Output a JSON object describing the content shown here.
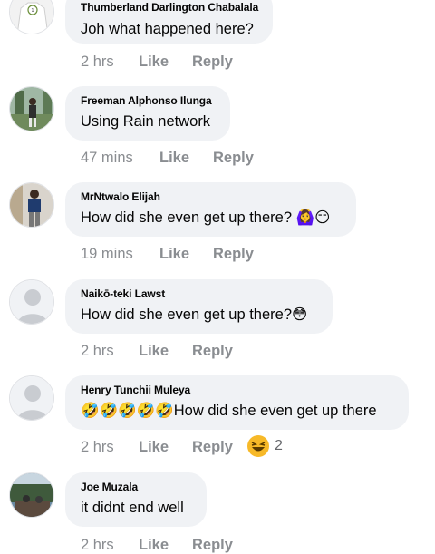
{
  "comments": [
    {
      "name": "Thumberland Darlington Chabalala",
      "text": "Joh what happened here?",
      "time": "2 hrs",
      "like": "Like",
      "reply": "Reply"
    },
    {
      "name": "Freeman Alphonso Ilunga",
      "text": "Using Rain network",
      "time": "47 mins",
      "like": "Like",
      "reply": "Reply"
    },
    {
      "name": "MrNtwalo Elijah",
      "text": "How did she even get up there? 🙆‍♀️😑",
      "time": "19 mins",
      "like": "Like",
      "reply": "Reply"
    },
    {
      "name": "Naikō-teki Lawst",
      "text": "How did she even get up there?😳",
      "time": "2 hrs",
      "like": "Like",
      "reply": "Reply"
    },
    {
      "name": "Henry Tunchii Muleya",
      "text": "🤣🤣🤣🤣🤣How did she even get up there",
      "time": "2 hrs",
      "like": "Like",
      "reply": "Reply",
      "reaction_count": "2"
    },
    {
      "name": "Joe Muzala",
      "text": "it didnt end well",
      "time": "2 hrs",
      "like": "Like",
      "reply": "Reply"
    }
  ],
  "colors": {
    "bubble": "#f0f2f5",
    "meta": "#8a8d91",
    "text": "#050505"
  },
  "icons": {
    "reaction": "laughing-reaction-icon"
  }
}
